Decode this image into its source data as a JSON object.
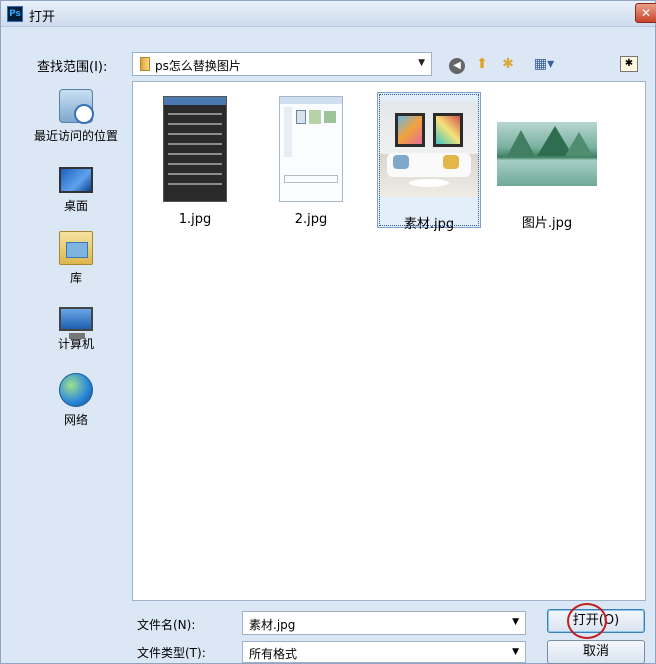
{
  "window": {
    "app_icon": "Ps",
    "title": "打开",
    "close_glyph": "✕"
  },
  "lookin": {
    "label": "查找范围(I):",
    "value": "ps怎么替换图片"
  },
  "toolbar": {
    "back_icon": "back-icon",
    "up_icon": "up-folder-icon",
    "new_folder_icon": "new-folder-icon",
    "view_menu_icon": "view-menu-icon",
    "desktop_icon": "desktop-shortcut-icon"
  },
  "places": [
    {
      "label": "最近访问的位置",
      "icon": "recent-places-icon"
    },
    {
      "label": "桌面",
      "icon": "desktop-icon"
    },
    {
      "label": "库",
      "icon": "library-icon"
    },
    {
      "label": "计算机",
      "icon": "computer-icon"
    },
    {
      "label": "网络",
      "icon": "network-icon"
    }
  ],
  "files": [
    {
      "name": "1.jpg",
      "selected": false
    },
    {
      "name": "2.jpg",
      "selected": false
    },
    {
      "name": "素材.jpg",
      "selected": true
    },
    {
      "name": "图片.jpg",
      "selected": false
    }
  ],
  "filename": {
    "label": "文件名(N):",
    "value": "素材.jpg"
  },
  "filetype": {
    "label": "文件类型(T):",
    "value": "所有格式"
  },
  "buttons": {
    "open": "打开(O)",
    "cancel": "取消"
  },
  "colors": {
    "highlight_circle": "#c21d1d",
    "selection": "#e3eefb"
  }
}
